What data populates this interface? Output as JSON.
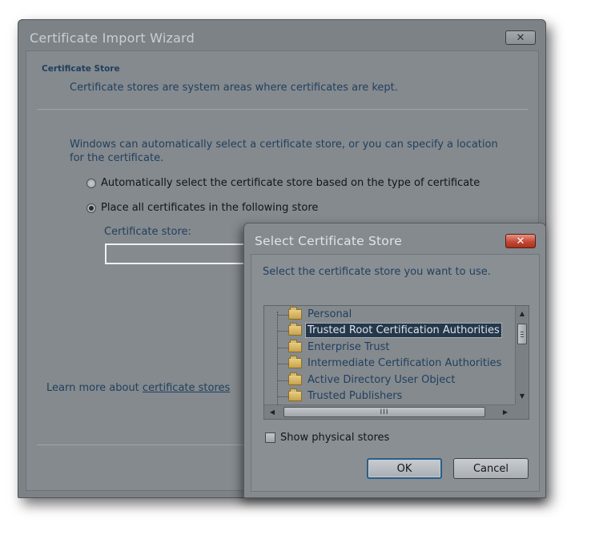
{
  "wizard": {
    "title": "Certificate Import Wizard",
    "close_glyph": "✕",
    "section_title": "Certificate Store",
    "section_desc": "Certificate stores are system areas where certificates are kept.",
    "auto_text": "Windows can automatically select a certificate store, or you can specify a location for the certificate.",
    "radio_auto": {
      "label": "Automatically select the certificate store based on the type of certificate",
      "selected": false
    },
    "radio_place": {
      "label": "Place all certificates in the following store",
      "selected": true
    },
    "store_label": "Certificate store:",
    "store_value": "",
    "learn_prefix": "Learn more about ",
    "learn_link": "certificate stores"
  },
  "dialog": {
    "title": "Select Certificate Store",
    "close_glyph": "✕",
    "prompt": "Select the certificate store you want to use.",
    "stores": [
      {
        "label": "Personal",
        "selected": false
      },
      {
        "label": "Trusted Root Certification Authorities",
        "selected": true
      },
      {
        "label": "Enterprise Trust",
        "selected": false
      },
      {
        "label": "Intermediate Certification Authorities",
        "selected": false
      },
      {
        "label": "Active Directory User Object",
        "selected": false
      },
      {
        "label": "Trusted Publishers",
        "selected": false
      }
    ],
    "show_physical_label": "Show physical stores",
    "show_physical_checked": false,
    "ok_label": "OK",
    "cancel_label": "Cancel",
    "hscroll_grip": "III"
  }
}
